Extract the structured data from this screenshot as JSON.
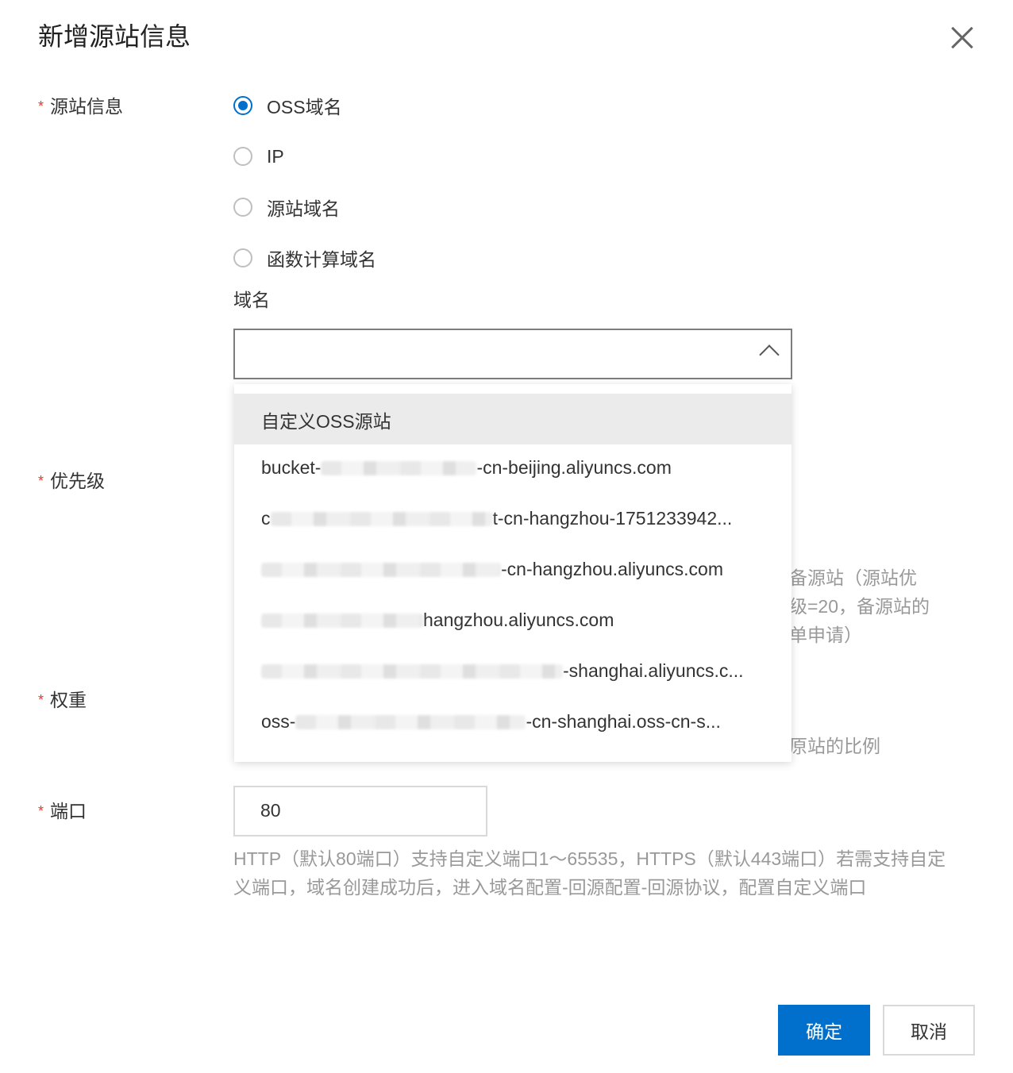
{
  "dialog": {
    "title": "新增源站信息",
    "close_icon": "close-icon"
  },
  "origin": {
    "label": "源站信息",
    "required_mark": "*",
    "options": [
      {
        "label": "OSS域名",
        "checked": true
      },
      {
        "label": "IP",
        "checked": false
      },
      {
        "label": "源站域名",
        "checked": false
      },
      {
        "label": "函数计算域名",
        "checked": false
      }
    ],
    "domain_label": "域名",
    "select_value": "",
    "dropdown": {
      "header": "自定义OSS源站",
      "items": [
        {
          "prefix": "bucket-",
          "suffix": "-cn-beijing.aliyuncs.com"
        },
        {
          "prefix": "c",
          "suffix": "t-cn-hangzhou-1751233942..."
        },
        {
          "prefix": "",
          "suffix": "-cn-hangzhou.aliyuncs.com"
        },
        {
          "prefix": "",
          "suffix": "hangzhou.aliyuncs.com"
        },
        {
          "prefix": "",
          "suffix": "-shanghai.aliyuncs.c..."
        },
        {
          "prefix": "oss-",
          "suffix": "-cn-shanghai.oss-cn-s..."
        }
      ]
    }
  },
  "priority": {
    "label": "优先级",
    "required_mark": "*",
    "hint_lines": [
      "备源站（源站优",
      "级=20，备源站的",
      "单申请）"
    ]
  },
  "weight": {
    "label": "权重",
    "required_mark": "*",
    "hint": "原站的比例"
  },
  "port": {
    "label": "端口",
    "required_mark": "*",
    "value": "80",
    "help": "HTTP（默认80端口）支持自定义端口1～65535，HTTPS（默认443端口）若需支持自定义端口，域名创建成功后，进入域名配置-回源配置-回源协议，配置自定义端口"
  },
  "footer": {
    "ok_label": "确定",
    "cancel_label": "取消"
  },
  "colors": {
    "primary": "#0070cc",
    "required": "#e5382d"
  }
}
